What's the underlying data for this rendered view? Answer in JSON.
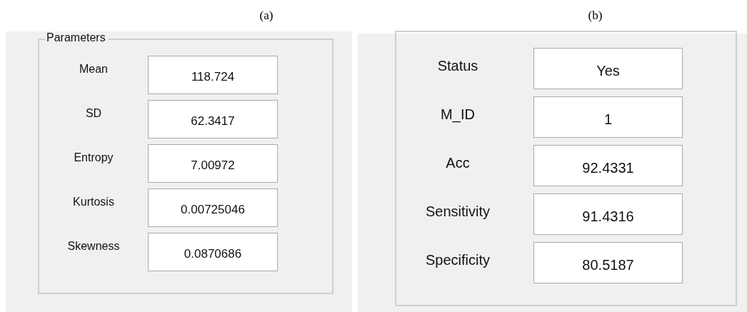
{
  "panels": [
    {
      "caption": "(a)",
      "group_title": "Parameters",
      "fields": [
        {
          "label": "Mean",
          "value": "118.724"
        },
        {
          "label": "SD",
          "value": "62.3417"
        },
        {
          "label": "Entropy",
          "value": "7.00972"
        },
        {
          "label": "Kurtosis",
          "value": "0.00725046"
        },
        {
          "label": "Skewness",
          "value": "0.0870686"
        }
      ]
    },
    {
      "caption": "(b)",
      "fields": [
        {
          "label": "Status",
          "value": "Yes"
        },
        {
          "label": "M_ID",
          "value": "1"
        },
        {
          "label": "Acc",
          "value": "92.4331"
        },
        {
          "label": "Sensitivity",
          "value": "91.4316"
        },
        {
          "label": "Specificity",
          "value": "80.5187"
        }
      ]
    }
  ]
}
